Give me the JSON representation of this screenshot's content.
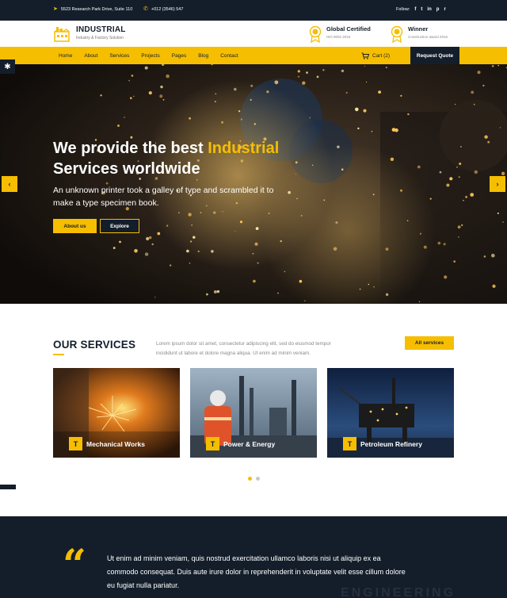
{
  "topbar": {
    "address": "5523 Research Park Drive, Suite 110",
    "phone": "+012 (3546) 547",
    "follow_label": "Follow:",
    "social_icons": [
      "facebook-icon",
      "twitter-icon",
      "linkedin-icon",
      "pinterest-icon",
      "rss-icon"
    ],
    "social_glyphs": [
      "f",
      "t",
      "in",
      "p",
      "r"
    ]
  },
  "header": {
    "brand": "INDUSTRIAL",
    "tagline": "Industry & Factory Solution",
    "awards": [
      {
        "title": "Global Certified",
        "subtitle": "ISO 9001:2016"
      },
      {
        "title": "Winner",
        "subtitle": "Construction award 2016"
      }
    ]
  },
  "nav": {
    "items": [
      "Home",
      "About",
      "Services",
      "Projects",
      "Pages",
      "Blog",
      "Contact"
    ],
    "cart_label": "Cart (2)",
    "cta": "Request Quote"
  },
  "hero": {
    "heading_part1": "We provide the best ",
    "heading_highlight": "Industrial",
    "heading_part2": "Services worldwide",
    "subtitle": "An unknown printer took a galley of type and scrambled it to make a type specimen book.",
    "primary_button": "About us",
    "secondary_button": "Explore"
  },
  "services": {
    "title": "OUR SERVICES",
    "description": "Lorem ipsum dolor sit amet, consectetur adipiscing elit, sed do eiusmod tempor incididunt ut labore et dolore magna aliqua. Ut enim ad minim veniam.",
    "all_button": "All services",
    "cards": [
      {
        "label": "Mechanical Works"
      },
      {
        "label": "Power & Energy"
      },
      {
        "label": "Petroleum Refinery"
      }
    ],
    "badge_glyph": "T",
    "carousel_active_index": 0,
    "carousel_count": 2
  },
  "testimonial": {
    "quote_glyph": "“",
    "text": "Ut enim ad minim veniam, quis nostrud exercitation ullamco laboris nisi ut aliquip ex ea commodo consequat. Duis aute irure dolor in reprehenderit in voluptate velit esse cillum dolore eu fugiat nulla pariatur.",
    "watermark": "ENGINEERING"
  },
  "colors": {
    "accent": "#f6be00",
    "dark": "#141e2b"
  }
}
